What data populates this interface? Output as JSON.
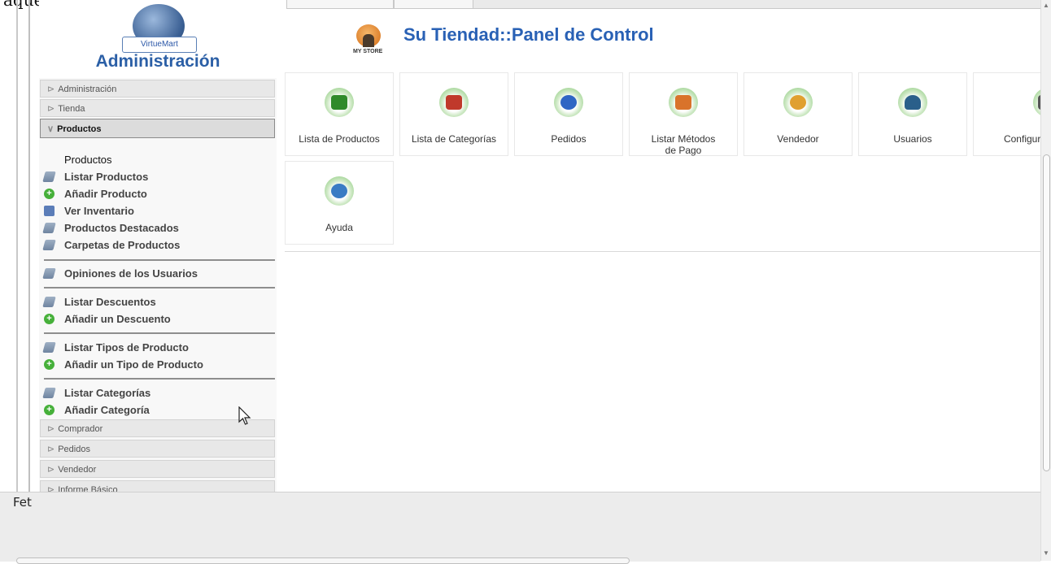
{
  "top_text": "aquest apartat.",
  "sidebar": {
    "logo_ribbon": "VirtueMart",
    "title": "Administración",
    "sections": [
      {
        "label": "Administración",
        "open": false
      },
      {
        "label": "Tienda",
        "open": false
      },
      {
        "label": "Productos",
        "open": true
      }
    ],
    "group_title": "Productos",
    "items": [
      {
        "label": "Listar Productos",
        "icon": "list-icon"
      },
      {
        "label": "Añadir Producto",
        "icon": "add-icon"
      },
      {
        "label": "Ver Inventario",
        "icon": "inventory-icon"
      },
      {
        "label": "Productos Destacados",
        "icon": "list-icon"
      },
      {
        "label": "Carpetas de Productos",
        "icon": "list-icon"
      },
      {
        "label": "Opiniones de los Usuarios",
        "icon": "list-icon"
      },
      {
        "label": "Listar Descuentos",
        "icon": "list-icon"
      },
      {
        "label": "Añadir un Descuento",
        "icon": "add-icon"
      },
      {
        "label": "Listar Tipos de Producto",
        "icon": "list-icon"
      },
      {
        "label": "Añadir un Tipo de Producto",
        "icon": "add-icon"
      },
      {
        "label": "Listar Categorías",
        "icon": "list-icon"
      },
      {
        "label": "Añadir Categoría",
        "icon": "add-icon"
      }
    ],
    "bottom_sections": [
      {
        "label": "Comprador"
      },
      {
        "label": "Pedidos"
      },
      {
        "label": "Vendedor"
      },
      {
        "label": "Informe Básico"
      }
    ]
  },
  "main": {
    "store_label": "MY STORE",
    "title": "Su Tiendad::Panel de Control",
    "tiles": [
      {
        "label": "Lista de Productos",
        "icon": "products-icon",
        "color": "#2f8a2a"
      },
      {
        "label": "Lista de Categorías",
        "icon": "categories-icon",
        "color": "#c0392b"
      },
      {
        "label": "Pedidos",
        "icon": "orders-icon",
        "color": "#2f66c4"
      },
      {
        "label": "Listar Métodos de Pago",
        "icon": "payment-icon",
        "color": "#d9732b"
      },
      {
        "label": "Vendedor",
        "icon": "vendor-icon",
        "color": "#e0a030"
      },
      {
        "label": "Usuarios",
        "icon": "users-icon",
        "color": "#2a5f8a"
      },
      {
        "label": "Configura",
        "icon": "config-icon",
        "color": "#555555"
      },
      {
        "label": "Ayuda",
        "icon": "help-icon",
        "color": "#3a7cc4"
      }
    ]
  },
  "status": {
    "text": "Fet"
  },
  "colors": {
    "title_blue": "#2961b5",
    "admin_blue": "#2b5fa6"
  }
}
